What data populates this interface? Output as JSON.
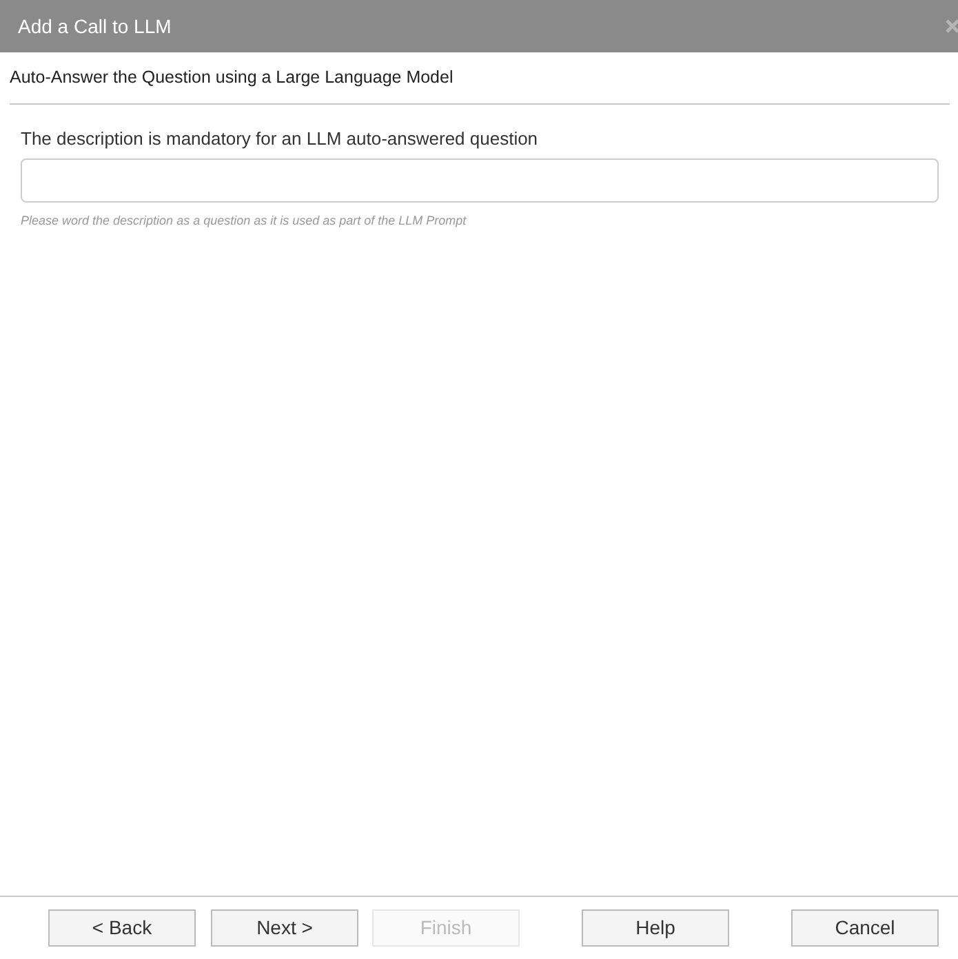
{
  "window": {
    "title": "Add a Call to LLM"
  },
  "heading": "Auto-Answer the Question using a Large Language Model",
  "field": {
    "label": "The description is mandatory for an LLM auto-answered question",
    "hint": "Please word the description as a question as it is used as part of the LLM Prompt"
  },
  "buttons": [
    {
      "label": "< Back",
      "disabled": false
    },
    {
      "label": "Next >",
      "disabled": false
    },
    {
      "label": "Finish",
      "disabled": true
    },
    {
      "label": "Help",
      "disabled": false
    },
    {
      "label": "Cancel",
      "disabled": false
    }
  ]
}
